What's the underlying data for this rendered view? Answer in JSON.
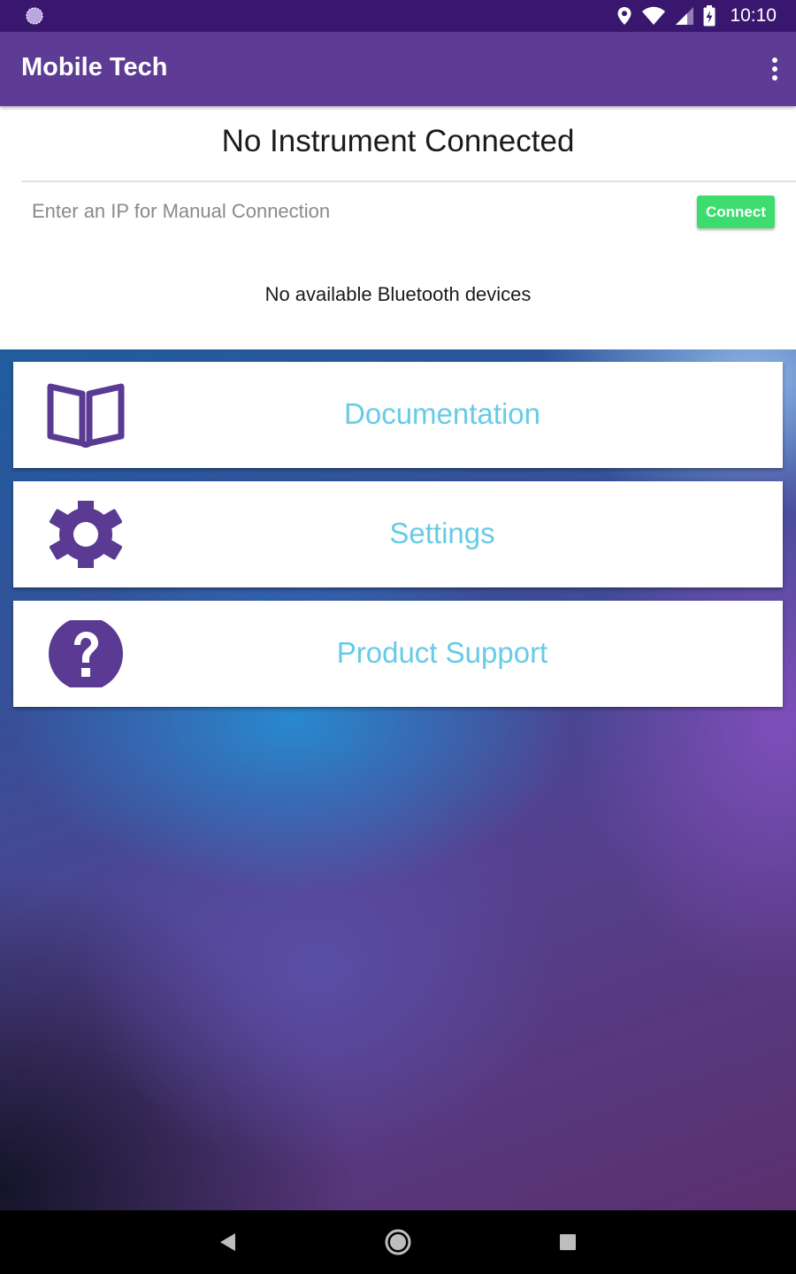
{
  "status_bar": {
    "time": "10:10",
    "icons": [
      "app-notification-icon",
      "location-icon",
      "wifi-icon",
      "cell-signal-icon",
      "battery-charging-icon"
    ]
  },
  "app_bar": {
    "title": "Mobile Tech",
    "overflow_icon": "more-vertical-icon"
  },
  "connection": {
    "title": "No Instrument Connected",
    "ip_placeholder": "Enter an IP for Manual Connection",
    "ip_value": "",
    "connect_label": "Connect",
    "bluetooth_status": "No available Bluetooth devices"
  },
  "menu": [
    {
      "label": "Documentation",
      "icon": "book-icon"
    },
    {
      "label": "Settings",
      "icon": "gear-icon"
    },
    {
      "label": "Product Support",
      "icon": "help-circle-icon"
    }
  ],
  "nav_bar": {
    "icons": [
      "back-icon",
      "home-icon",
      "recents-icon"
    ]
  },
  "colors": {
    "status_bar": "#3a176f",
    "app_bar": "#5e3b94",
    "icon_purple": "#5a3a92",
    "label_cyan": "#67cbe6",
    "connect_green": "#3ddc6f"
  }
}
